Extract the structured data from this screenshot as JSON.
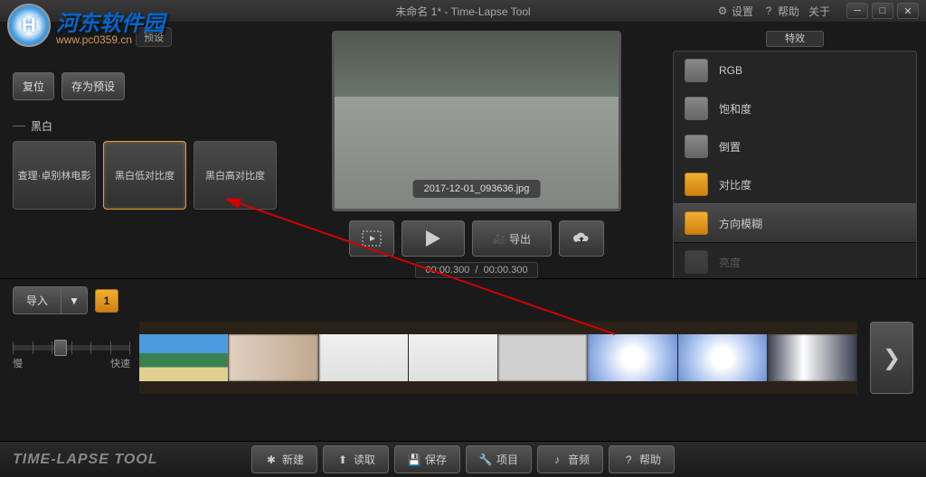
{
  "header": {
    "title": "未命名 1* - Time-Lapse Tool",
    "settings": "设置",
    "help": "帮助",
    "about": "关于",
    "logo_cn": "河东软件园",
    "logo_url": "www.pc0359.cn"
  },
  "left": {
    "preset_header": "预设",
    "reset": "复位",
    "save_as_preset": "存为预设",
    "section_bw": "黑白",
    "presets": [
      {
        "label": "查理·卓别林电影"
      },
      {
        "label": "黑白低对比度"
      },
      {
        "label": "黑白高对比度"
      }
    ]
  },
  "preview": {
    "filename": "2017-12-01_093636.jpg",
    "export": "导出",
    "time_current": "00:00.300",
    "time_total": "00:00.300"
  },
  "effects": {
    "header": "特效",
    "items": [
      {
        "label": "RGB",
        "active": false
      },
      {
        "label": "饱和度",
        "active": false
      },
      {
        "label": "倒置",
        "active": false
      },
      {
        "label": "对比度",
        "active": true
      },
      {
        "label": "方向模糊",
        "active": true,
        "group": true
      },
      {
        "label": "亮度",
        "active": false
      }
    ]
  },
  "timeline": {
    "import": "导入",
    "sequence_num": "1",
    "slow": "慢",
    "fast": "快速"
  },
  "footer": {
    "brand": "TIME-LAPSE TOOL",
    "new": "新建",
    "load": "读取",
    "save": "保存",
    "project": "项目",
    "audio": "音频",
    "help": "帮助"
  }
}
